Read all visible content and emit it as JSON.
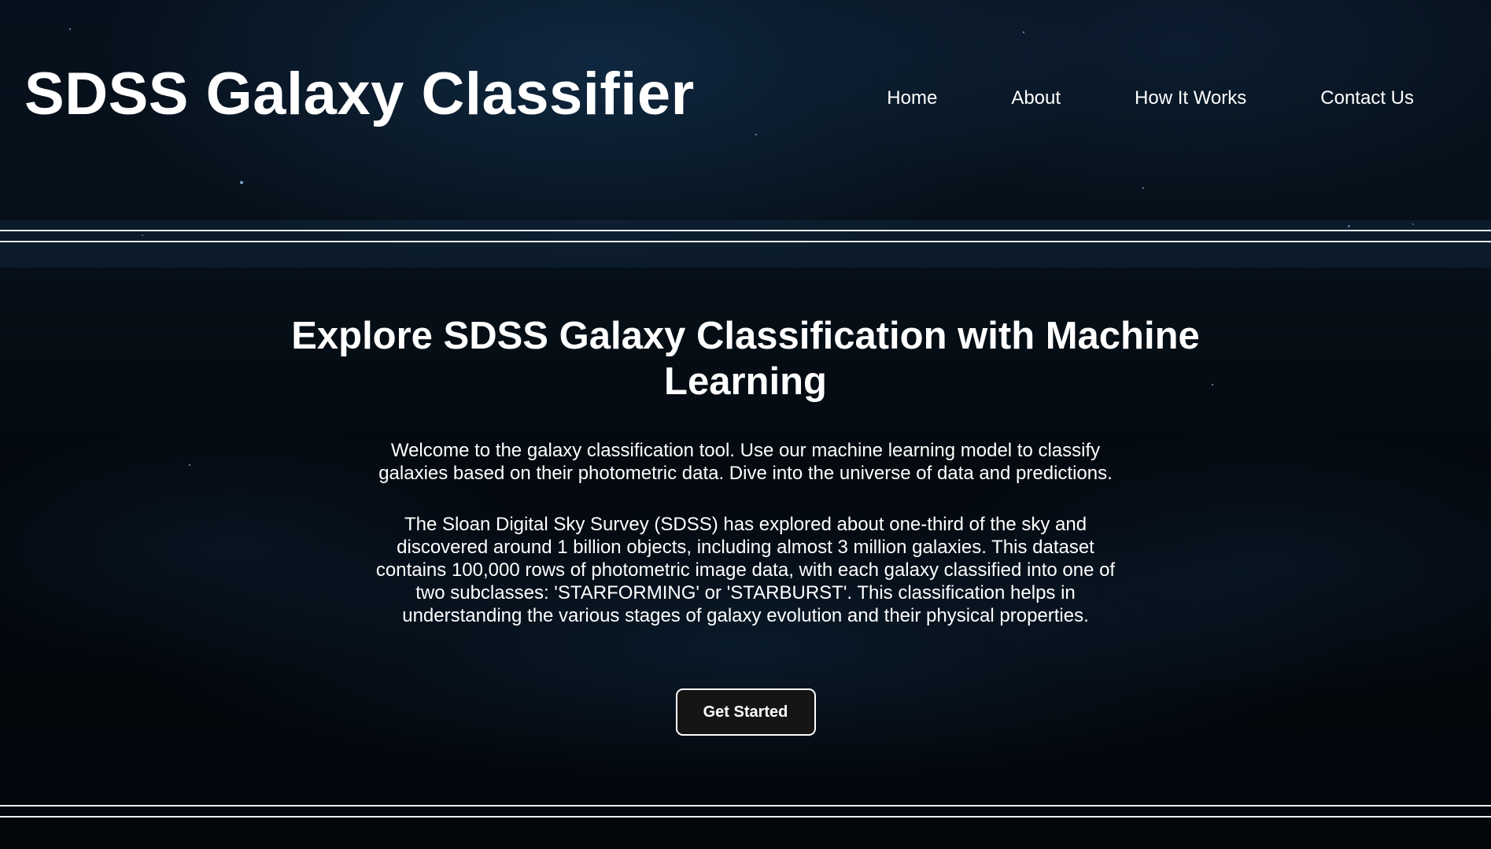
{
  "header": {
    "site_title": "SDSS Galaxy Classifier",
    "nav": [
      {
        "label": "Home"
      },
      {
        "label": "About"
      },
      {
        "label": "How It Works"
      },
      {
        "label": "Contact Us"
      }
    ]
  },
  "hero": {
    "heading": "Explore SDSS Galaxy Classification with Machine Learning",
    "intro": "Welcome to the galaxy classification tool. Use our machine learning model to classify galaxies based on their photometric data. Dive into the universe of data and predictions.",
    "about": "The Sloan Digital Sky Survey (SDSS) has explored about one-third of the sky and discovered around 1 billion objects, including almost 3 million galaxies. This dataset contains 100,000 rows of photometric image data, with each galaxy classified into one of two subclasses: 'STARFORMING' or 'STARBURST'. This classification helps in understanding the various stages of galaxy evolution and their physical properties.",
    "cta_label": "Get Started"
  },
  "colors": {
    "background": "#050a12",
    "text": "#ffffff",
    "rule": "#e9eef4",
    "button_bg": "#171414"
  }
}
